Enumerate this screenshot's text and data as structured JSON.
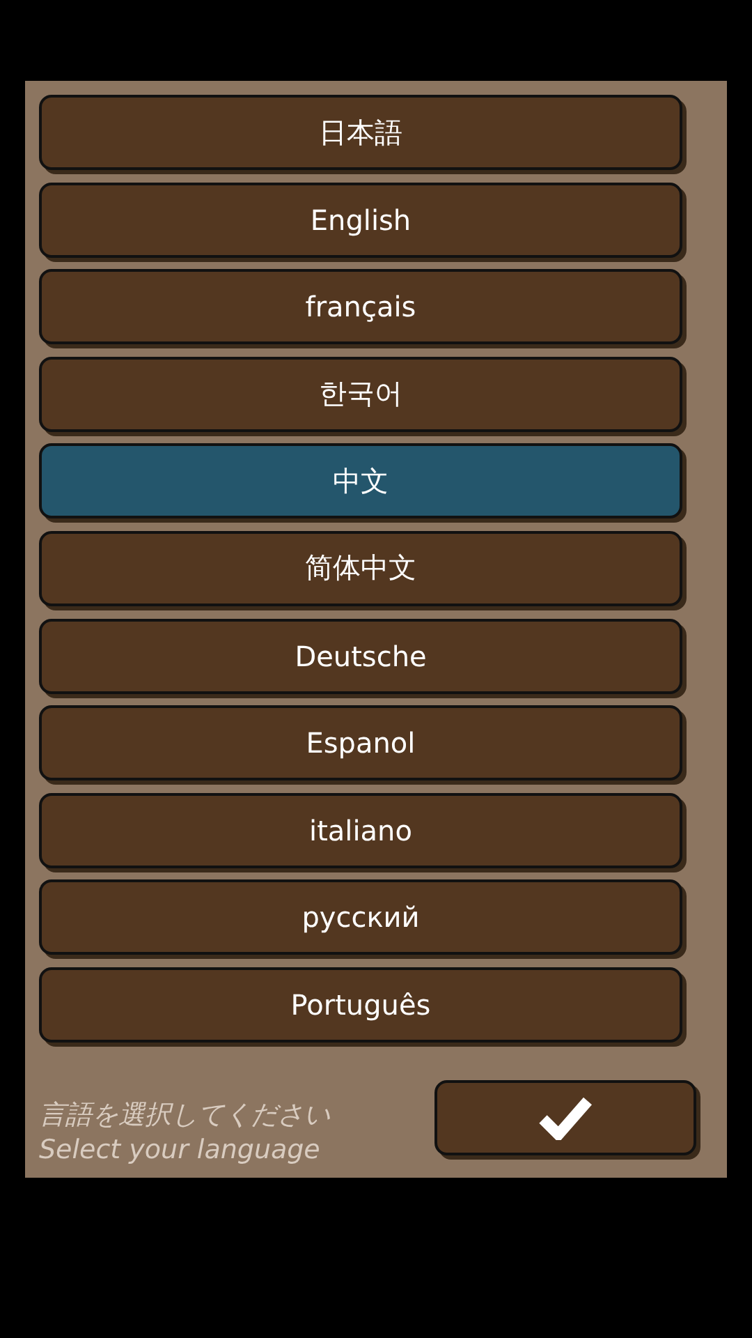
{
  "languages": [
    {
      "label": "日本語",
      "selected": false
    },
    {
      "label": "English",
      "selected": false
    },
    {
      "label": "français",
      "selected": false
    },
    {
      "label": "한국어",
      "selected": false
    },
    {
      "label": "中文",
      "selected": true
    },
    {
      "label": "简体中文",
      "selected": false
    },
    {
      "label": "Deutsche",
      "selected": false
    },
    {
      "label": "Espanol",
      "selected": false
    },
    {
      "label": "italiano",
      "selected": false
    },
    {
      "label": "русский",
      "selected": false
    },
    {
      "label": "Português",
      "selected": false
    }
  ],
  "prompt": {
    "japanese": "言語を選択してください",
    "english": "Select your language"
  }
}
